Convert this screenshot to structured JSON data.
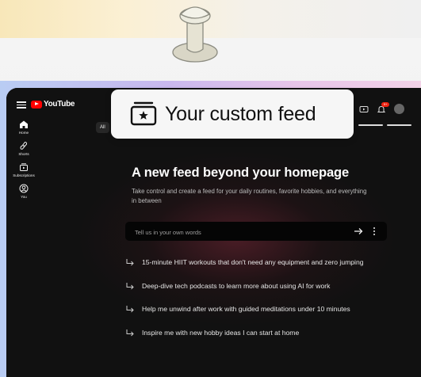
{
  "app": {
    "logo_text": "YouTube"
  },
  "callout": {
    "title": "Your custom feed",
    "icon": "star-feed-icon"
  },
  "chips": {
    "all_label": "All"
  },
  "header": {
    "notification_count": "9+"
  },
  "sidebar": {
    "items": [
      {
        "label": "Home",
        "icon": "home-icon"
      },
      {
        "label": "Shorts",
        "icon": "shorts-icon"
      },
      {
        "label": "Subscriptions",
        "icon": "subscriptions-icon"
      },
      {
        "label": "You",
        "icon": "you-icon"
      }
    ]
  },
  "main": {
    "headline": "A new feed beyond your homepage",
    "description": "Take control and create a feed for your daily routines, favorite hobbies, and everything in between",
    "input_placeholder": "Tell us in your own words",
    "suggestions": [
      "15-minute HIIT workouts that don't need any equipment and zero jumping",
      "Deep-dive tech podcasts to learn more about using AI for work",
      "Help me unwind after work with guided meditations under 10 minutes",
      "Inspire me with new hobby ideas I can start at home"
    ]
  },
  "colors": {
    "brand_red": "#ff0000",
    "app_background": "#111111",
    "callout_background": "#f6f6f6"
  }
}
